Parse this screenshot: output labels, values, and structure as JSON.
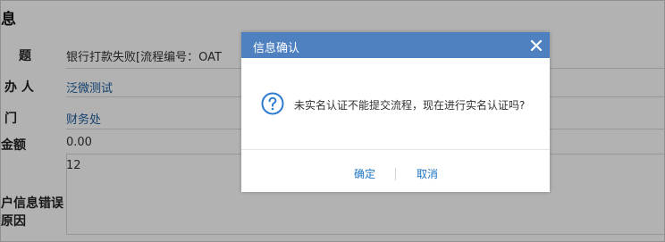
{
  "form": {
    "section_title": "息",
    "fields": [
      {
        "label": "题",
        "value": "银行打款失败[流程编号：OAT"
      },
      {
        "label": "办 人",
        "value": "泛微测试"
      },
      {
        "label": "门",
        "value": "财务处"
      },
      {
        "label": "金额",
        "value": "0.00"
      },
      {
        "label": "户信息错误原因",
        "value": "12"
      }
    ]
  },
  "dialog": {
    "title": "信息确认",
    "close_icon": "close-icon",
    "question_icon": "question-circle-icon",
    "message": "未实名认证不能提交流程，现在进行实名认证吗?",
    "confirm_label": "确定",
    "cancel_label": "取消"
  },
  "colors": {
    "dialog_header": "#4f81c1",
    "button_text": "#1c74c4",
    "link_text": "#1c5e9e",
    "overlay": "rgba(0,0,0,0.30)"
  }
}
